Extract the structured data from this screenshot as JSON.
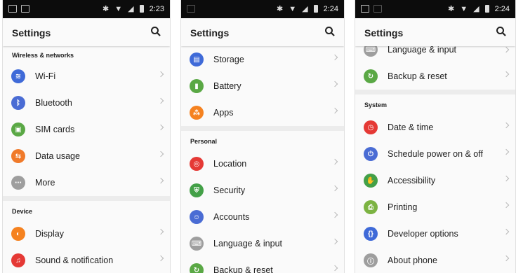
{
  "screens": [
    {
      "status": {
        "time": "2:23"
      },
      "title": "Settings",
      "sections": [
        {
          "header": "Wireless & networks",
          "items": [
            {
              "label": "Wi-Fi",
              "icon": "wifi-icon",
              "color": "#3f6ad8",
              "glyph": "≋"
            },
            {
              "label": "Bluetooth",
              "icon": "bluetooth-icon",
              "color": "#4a6cd4",
              "glyph": "ᛒ"
            },
            {
              "label": "SIM cards",
              "icon": "sim-card-icon",
              "color": "#5aa845",
              "glyph": "▣"
            },
            {
              "label": "Data usage",
              "icon": "data-usage-icon",
              "color": "#f07a2a",
              "glyph": "⇆"
            },
            {
              "label": "More",
              "icon": "more-icon",
              "color": "#9e9e9e",
              "glyph": "⋯"
            }
          ]
        },
        {
          "header": "Device",
          "items": [
            {
              "label": "Display",
              "icon": "display-icon",
              "color": "#f58220",
              "glyph": "◐"
            },
            {
              "label": "Sound & notification",
              "icon": "bell-icon",
              "color": "#e53935",
              "glyph": "♫"
            }
          ]
        }
      ]
    },
    {
      "status": {
        "time": "2:24"
      },
      "title": "Settings",
      "sections": [
        {
          "header": "",
          "items": [
            {
              "label": "Storage",
              "icon": "storage-icon",
              "color": "#3f6ad8",
              "glyph": "▤"
            },
            {
              "label": "Battery",
              "icon": "battery-icon",
              "color": "#5aa845",
              "glyph": "▮"
            },
            {
              "label": "Apps",
              "icon": "apps-icon",
              "color": "#f58220",
              "glyph": "⁂"
            }
          ]
        },
        {
          "header": "Personal",
          "items": [
            {
              "label": "Location",
              "icon": "location-icon",
              "color": "#e53935",
              "glyph": "◎"
            },
            {
              "label": "Security",
              "icon": "shield-icon",
              "color": "#43a047",
              "glyph": "⛨"
            },
            {
              "label": "Accounts",
              "icon": "accounts-icon",
              "color": "#4a6cd4",
              "glyph": "☺"
            },
            {
              "label": "Language & input",
              "icon": "language-icon",
              "color": "#9e9e9e",
              "glyph": "⌨"
            },
            {
              "label": "Backup & reset",
              "icon": "backup-icon",
              "color": "#5aa845",
              "glyph": "↻"
            }
          ]
        }
      ]
    },
    {
      "status": {
        "time": "2:24"
      },
      "title": "Settings",
      "sections": [
        {
          "header": "",
          "items": [
            {
              "label": "Language & input",
              "icon": "language-icon",
              "color": "#9e9e9e",
              "glyph": "⌨",
              "partial": true
            },
            {
              "label": "Backup & reset",
              "icon": "backup-icon",
              "color": "#5aa845",
              "glyph": "↻"
            }
          ]
        },
        {
          "header": "System",
          "items": [
            {
              "label": "Date & time",
              "icon": "clock-icon",
              "color": "#e53935",
              "glyph": "◷"
            },
            {
              "label": "Schedule power on & off",
              "icon": "power-schedule-icon",
              "color": "#4a6cd4",
              "glyph": "⏻"
            },
            {
              "label": "Accessibility",
              "icon": "accessibility-icon",
              "color": "#43a047",
              "glyph": "✋"
            },
            {
              "label": "Printing",
              "icon": "printer-icon",
              "color": "#7cb342",
              "glyph": "⎙"
            },
            {
              "label": "Developer options",
              "icon": "developer-icon",
              "color": "#3f6ad8",
              "glyph": "{}"
            },
            {
              "label": "About phone",
              "icon": "info-icon",
              "color": "#9e9e9e",
              "glyph": "ⓘ"
            }
          ]
        }
      ]
    }
  ]
}
